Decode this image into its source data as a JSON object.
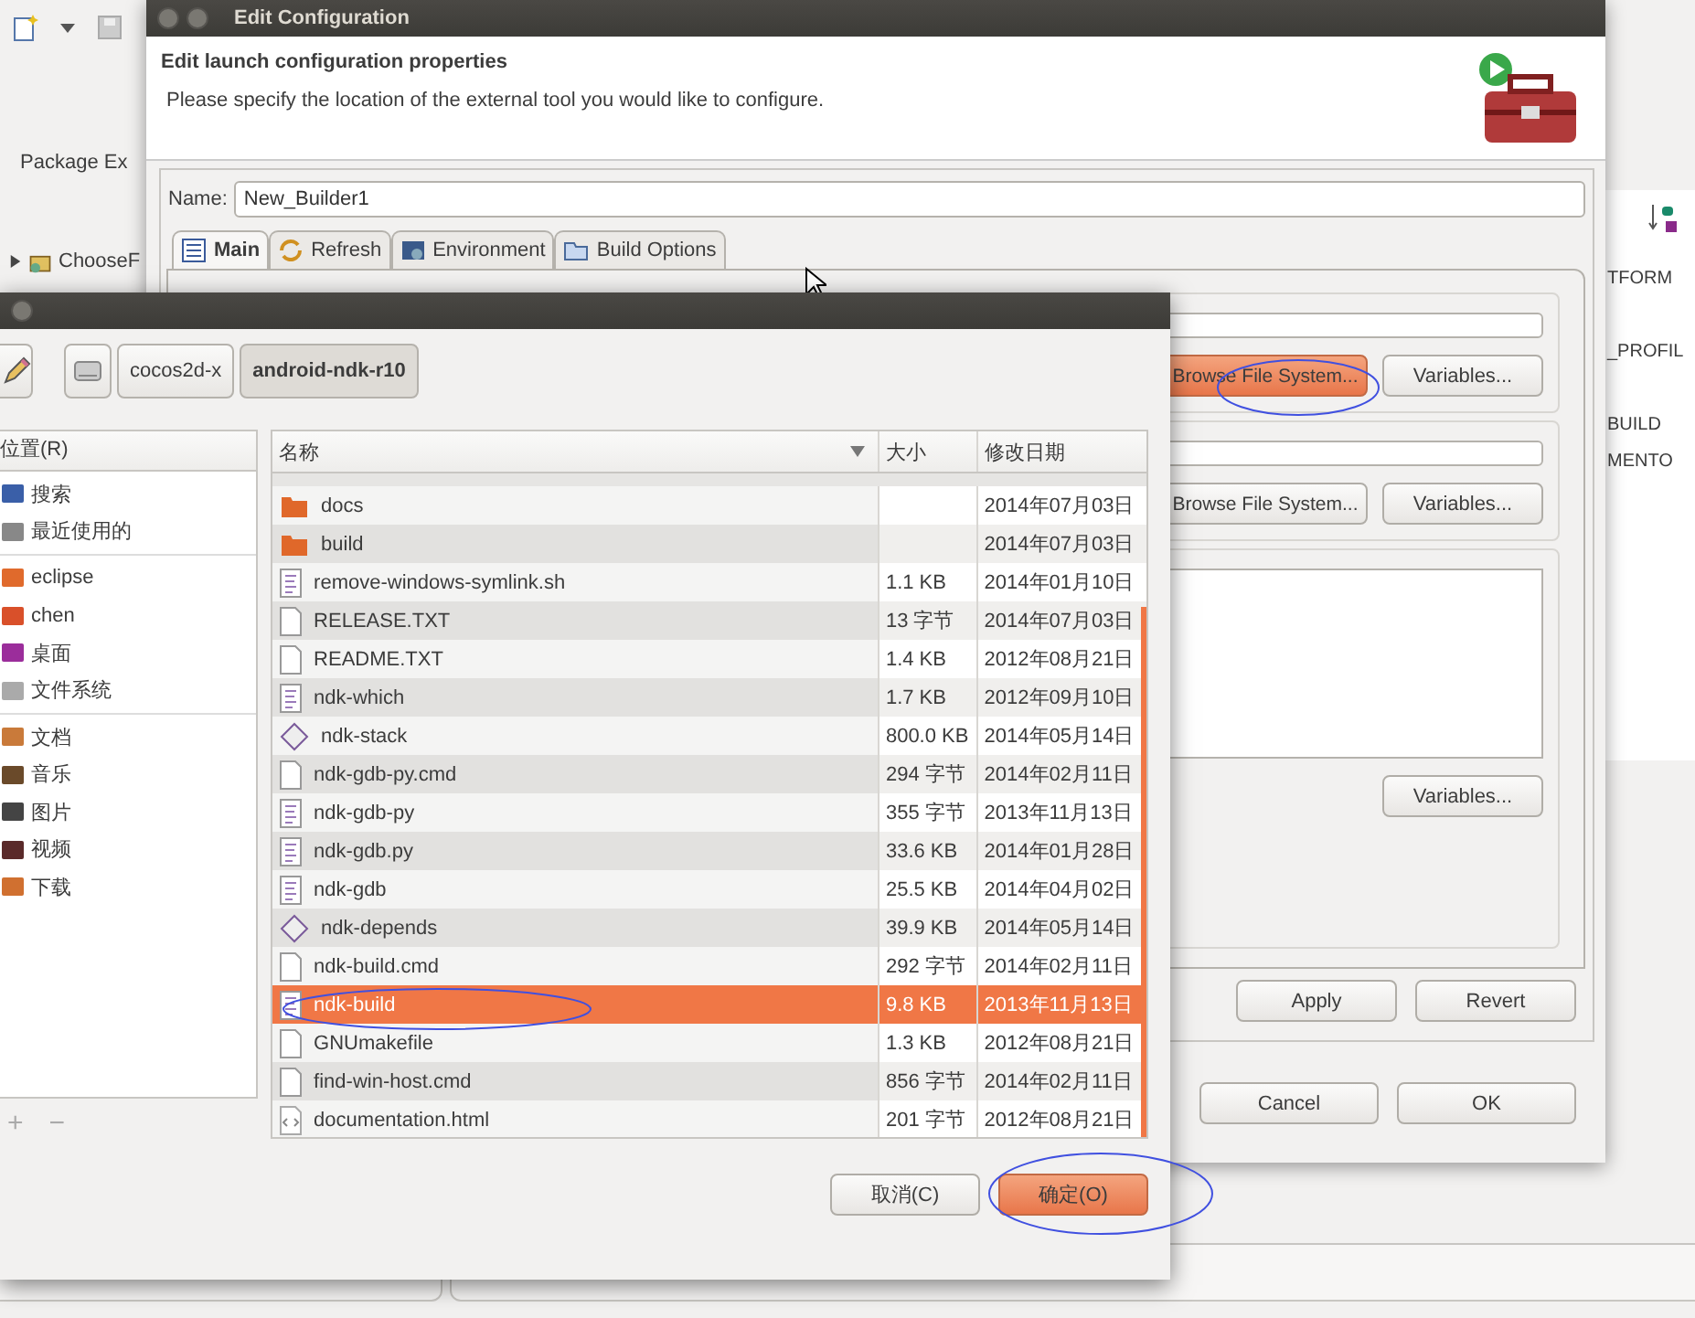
{
  "eclipse": {
    "package_tab": "Package Ex",
    "tree_item": "ChooseF",
    "outline_items": [
      "TFORM",
      "_PROFIL",
      "BUILD",
      "MENTO"
    ]
  },
  "config_dialog": {
    "title": "Edit Configuration",
    "heading": "Edit launch configuration properties",
    "description": "Please specify the location of the external tool you would like to configure.",
    "name_label": "Name:",
    "name_value": "New_Builder1",
    "tabs": [
      {
        "label": "Main",
        "kind": "main",
        "selected": true
      },
      {
        "label": "Refresh",
        "kind": "refresh",
        "selected": false
      },
      {
        "label": "Environment",
        "kind": "environment",
        "selected": false
      },
      {
        "label": "Build Options",
        "kind": "folder",
        "selected": false
      }
    ],
    "groups": [
      {
        "kind": "path",
        "browse": "Browse File System...",
        "browse_highlighted": true,
        "variables": "Variables..."
      },
      {
        "kind": "path",
        "browse": "Browse File System...",
        "browse_highlighted": false,
        "variables": "Variables..."
      },
      {
        "kind": "text",
        "variables": "Variables..."
      }
    ],
    "apply": "Apply",
    "revert": "Revert",
    "cancel": "Cancel",
    "ok": "OK"
  },
  "file_chooser": {
    "path_buttons": [
      {
        "label": "cocos2d-x",
        "selected": false
      },
      {
        "label": "android-ndk-r10",
        "selected": true
      }
    ],
    "places_header": "位置(R)",
    "places": [
      [
        {
          "label": "搜索",
          "kind": "search"
        },
        {
          "label": "最近使用的",
          "kind": "recent"
        }
      ],
      [
        {
          "label": "eclipse",
          "kind": "folder"
        },
        {
          "label": "chen",
          "kind": "home"
        },
        {
          "label": "桌面",
          "kind": "desktop"
        },
        {
          "label": "文件系统",
          "kind": "drive"
        }
      ],
      [
        {
          "label": "文档",
          "kind": "documents"
        },
        {
          "label": "音乐",
          "kind": "music"
        },
        {
          "label": "图片",
          "kind": "pictures"
        },
        {
          "label": "视频",
          "kind": "videos"
        },
        {
          "label": "下载",
          "kind": "downloads"
        }
      ]
    ],
    "add": "+",
    "remove": "−",
    "columns": [
      "名称",
      "大小",
      "修改日期"
    ],
    "files": [
      {
        "name": "docs",
        "kind": "folder",
        "date": "2014年07月03日",
        "selected": false
      },
      {
        "name": "build",
        "kind": "folder",
        "date": "2014年07月03日",
        "selected": false
      },
      {
        "name": "remove-windows-symlink.sh",
        "kind": "script",
        "size": "1.1 KB",
        "date": "2014年01月10日",
        "selected": false
      },
      {
        "name": "RELEASE.TXT",
        "kind": "plain",
        "size": "13 字节",
        "date": "2014年07月03日",
        "selected": false
      },
      {
        "name": "README.TXT",
        "kind": "plain",
        "size": "1.4 KB",
        "date": "2012年08月21日",
        "selected": false
      },
      {
        "name": "ndk-which",
        "kind": "script",
        "size": "1.7 KB",
        "date": "2012年09月10日",
        "selected": false
      },
      {
        "name": "ndk-stack",
        "kind": "binary",
        "size": "800.0 KB",
        "date": "2014年05月14日",
        "selected": false
      },
      {
        "name": "ndk-gdb-py.cmd",
        "kind": "plain",
        "size": "294 字节",
        "date": "2014年02月11日",
        "selected": false
      },
      {
        "name": "ndk-gdb-py",
        "kind": "script",
        "size": "355 字节",
        "date": "2013年11月13日",
        "selected": false
      },
      {
        "name": "ndk-gdb.py",
        "kind": "script",
        "size": "33.6 KB",
        "date": "2014年01月28日",
        "selected": false
      },
      {
        "name": "ndk-gdb",
        "kind": "script",
        "size": "25.5 KB",
        "date": "2014年04月02日",
        "selected": false
      },
      {
        "name": "ndk-depends",
        "kind": "binary",
        "size": "39.9 KB",
        "date": "2014年05月14日",
        "selected": false
      },
      {
        "name": "ndk-build.cmd",
        "kind": "plain",
        "size": "292 字节",
        "date": "2014年02月11日",
        "selected": false
      },
      {
        "name": "ndk-build",
        "kind": "script",
        "size": "9.8 KB",
        "date": "2013年11月13日",
        "selected": true
      },
      {
        "name": "GNUmakefile",
        "kind": "plain",
        "size": "1.3 KB",
        "date": "2012年08月21日",
        "selected": false
      },
      {
        "name": "find-win-host.cmd",
        "kind": "plain",
        "size": "856 字节",
        "date": "2014年02月11日",
        "selected": false
      },
      {
        "name": "documentation.html",
        "kind": "html",
        "size": "201 字节",
        "date": "2012年08月21日",
        "selected": false
      }
    ],
    "cancel": "取消(C)",
    "ok": "确定(O)"
  }
}
